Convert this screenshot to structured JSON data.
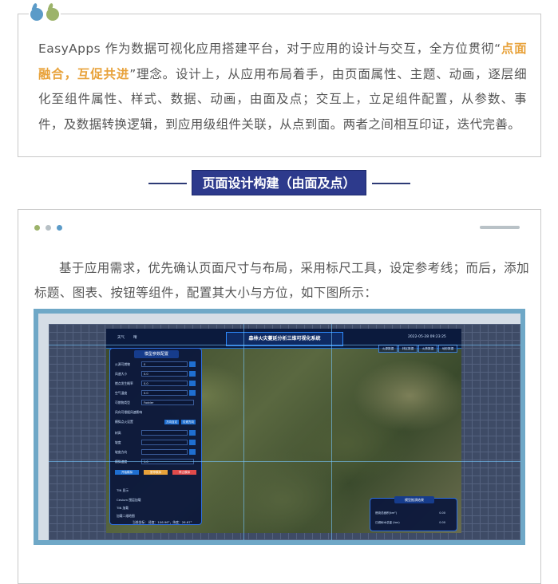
{
  "intro": {
    "before": "EasyApps 作为数据可视化应用搭建平台，对于应用的设计与交互，全方位贯彻“",
    "highlight": "点面融合，互促共进",
    "after": "”理念。设计上，从应用布局着手，由页面属性、主题、动画，逐层细化至组件属性、样式、数据、动画，由面及点；交互上，立足组件配置，从参数、事件，及数据转换逻辑，到应用级组件关联，从点到面。两者之间相互印证，迭代完善。"
  },
  "section": {
    "title": "页面设计构建（由面及点）"
  },
  "body": {
    "paragraph": "基于应用需求，优先确认页面尺寸与布局，采用标尺工具，设定参考线；而后，添加标题、图表、按钮等组件，配置其大小与方位，如下图所示："
  },
  "screenshot": {
    "app_title": "森林火灾蔓延分析三维可视化系统",
    "datetime": "2022-05-28 09:23:25",
    "header_left": "天气",
    "header_left2": "晴",
    "panel_title": "模型参数配置",
    "panel_rows": [
      {
        "label": "火源可燃物",
        "value": "0"
      },
      {
        "label": "风速大小",
        "value": "0.0"
      },
      {
        "label": "燃点发生概率",
        "value": "0.0"
      },
      {
        "label": "空气湿度",
        "value": "0.0"
      },
      {
        "label": "可燃物类型",
        "value": "Fodder"
      }
    ],
    "checkbox_label": "风向可根据风速影响",
    "section2_label": "模拟点火设置",
    "small_btns": [
      "方向自定",
      "引燃方向"
    ],
    "panel_rows2": [
      {
        "label": "树高",
        "value": ""
      },
      {
        "label": "坡度",
        "value": ""
      },
      {
        "label": "坡度方向",
        "value": ""
      }
    ],
    "slider_label": "模拟速度",
    "slider_value": "1.0",
    "action_btns": [
      "开始模拟",
      "暂停模拟",
      "停止模拟"
    ],
    "lower_labels": [
      "TIN 显示",
      "Cesium 图层加载",
      "TIN 加载",
      "加载二维地图"
    ],
    "coord_label": "当前坐标：",
    "coord_value": "经度：106.96°，纬度：26.67°",
    "tabs": [
      "火源数据",
      "林区数据",
      "火势数据",
      "地形数据"
    ],
    "result_title": "模型推演结果",
    "results": [
      {
        "label": "燃烧总面积(km²)",
        "value": "0.00"
      },
      {
        "label": "已燃树木总量 (ton)",
        "value": "0.00"
      }
    ]
  },
  "colors": {
    "accent": "#2d3a8c",
    "highlight": "#e8a23a",
    "frame": "#6fa8c7"
  }
}
